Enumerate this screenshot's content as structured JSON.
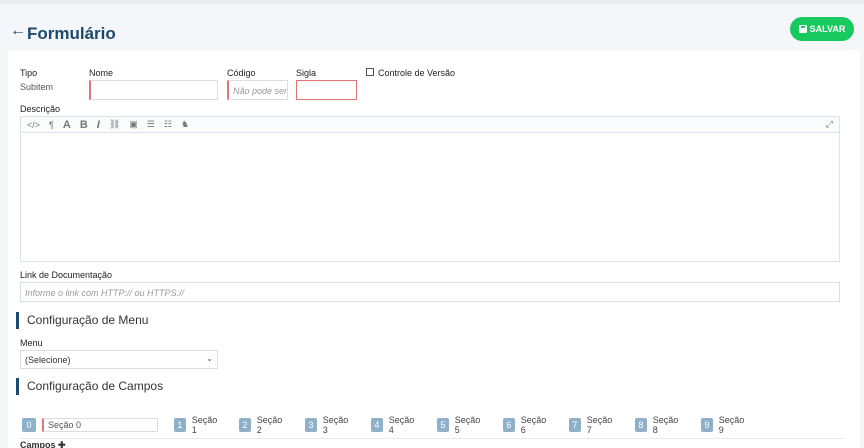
{
  "header": {
    "back_icon": "←",
    "title": "Formulário",
    "save_label": "SALVAR"
  },
  "form": {
    "tipo_label": "Tipo",
    "tipo_value": "Subitem",
    "nome_label": "Nome",
    "nome_value": "",
    "codigo_label": "Código",
    "codigo_placeholder": "Não pode ser",
    "sigla_label": "Sigla",
    "sigla_value": "",
    "controle_label": "Controle de Versão",
    "descricao_label": "Descrição",
    "toolbar": [
      "</>",
      "¶",
      "A",
      "B",
      "I",
      "⛓",
      "▣",
      "☰",
      "☷",
      "♞"
    ],
    "link_label": "Link de Documentação",
    "link_placeholder": "Informe o link com HTTP:// ou HTTPS://"
  },
  "menu_section": {
    "title": "Configuração de Menu",
    "menu_label": "Menu",
    "menu_value": "(Selecione)"
  },
  "campos_section": {
    "title": "Configuração de Campos",
    "tabs": [
      {
        "num": "0",
        "label": "Seção 0"
      },
      {
        "num": "1",
        "label": "Seção 1"
      },
      {
        "num": "2",
        "label": "Seção 2"
      },
      {
        "num": "3",
        "label": "Seção 3"
      },
      {
        "num": "4",
        "label": "Seção 4"
      },
      {
        "num": "5",
        "label": "Seção 5"
      },
      {
        "num": "6",
        "label": "Seção 6"
      },
      {
        "num": "7",
        "label": "Seção 7"
      },
      {
        "num": "8",
        "label": "Seção 8"
      },
      {
        "num": "9",
        "label": "Seção 9"
      }
    ],
    "campos_label": "Campos ✚"
  }
}
